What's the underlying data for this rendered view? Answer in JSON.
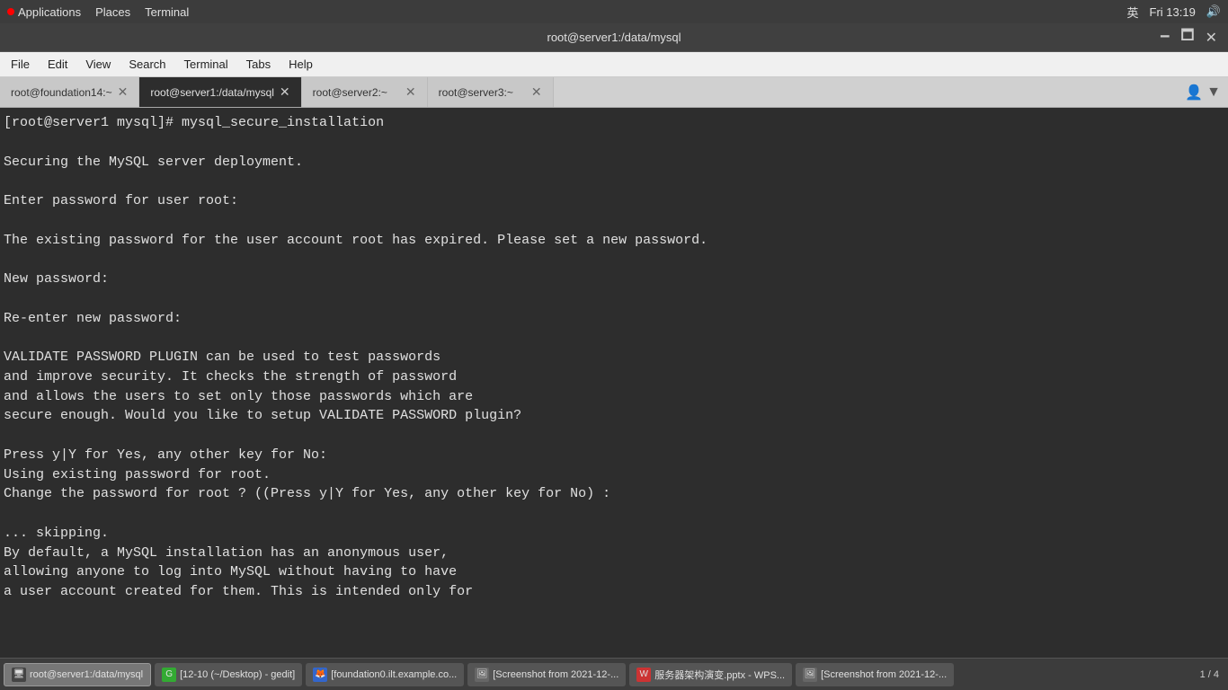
{
  "system_bar": {
    "apps_label": "Applications",
    "places_label": "Places",
    "terminal_label": "Terminal",
    "lang": "英",
    "datetime": "Fri 13:19",
    "volume_icon": "🔊"
  },
  "title_bar": {
    "title": "root@server1:/data/mysql",
    "minimize": "🗕",
    "maximize": "🗖",
    "close": "✕"
  },
  "menu": {
    "file": "File",
    "edit": "Edit",
    "view": "View",
    "search": "Search",
    "terminal": "Terminal",
    "tabs": "Tabs",
    "help": "Help"
  },
  "tabs": [
    {
      "label": "root@foundation14:~",
      "active": false
    },
    {
      "label": "root@server1:/data/mysql",
      "active": true
    },
    {
      "label": "root@server2:~",
      "active": false
    },
    {
      "label": "root@server3:~",
      "active": false
    }
  ],
  "terminal_content": "[root@server1 mysql]# mysql_secure_installation\n\nSecuring the MySQL server deployment.\n\nEnter password for user root:\n\nThe existing password for the user account root has expired. Please set a new password.\n\nNew password:\n\nRe-enter new password:\n\nVALIDATE PASSWORD PLUGIN can be used to test passwords\nand improve security. It checks the strength of password\nand allows the users to set only those passwords which are\nsecure enough. Would you like to setup VALIDATE PASSWORD plugin?\n\nPress y|Y for Yes, any other key for No:\nUsing existing password for root.\nChange the password for root ? ((Press y|Y for Yes, any other key for No) :\n\n... skipping.\nBy default, a MySQL installation has an anonymous user,\nallowing anyone to log into MySQL without having to have\na user account created for them. This is intended only for",
  "taskbar": {
    "items": [
      {
        "label": "root@server1:/data/mysql",
        "color": "#555",
        "active": true,
        "icon": "T"
      },
      {
        "label": "[12-10 (~/Desktop) - gedit]",
        "color": "#555",
        "active": false,
        "icon": "G"
      },
      {
        "label": "[foundation0.ilt.example.co...",
        "color": "#555",
        "active": false,
        "icon": "F"
      },
      {
        "label": "[Screenshot from 2021-12-...",
        "color": "#555",
        "active": false,
        "icon": "S"
      },
      {
        "label": "服务器架构演变.pptx - WPS...",
        "color": "#555",
        "active": false,
        "icon": "W"
      },
      {
        "label": "[Screenshot from 2021-12-...",
        "color": "#555",
        "active": false,
        "icon": "S"
      }
    ],
    "page_label": "1 / 4"
  }
}
